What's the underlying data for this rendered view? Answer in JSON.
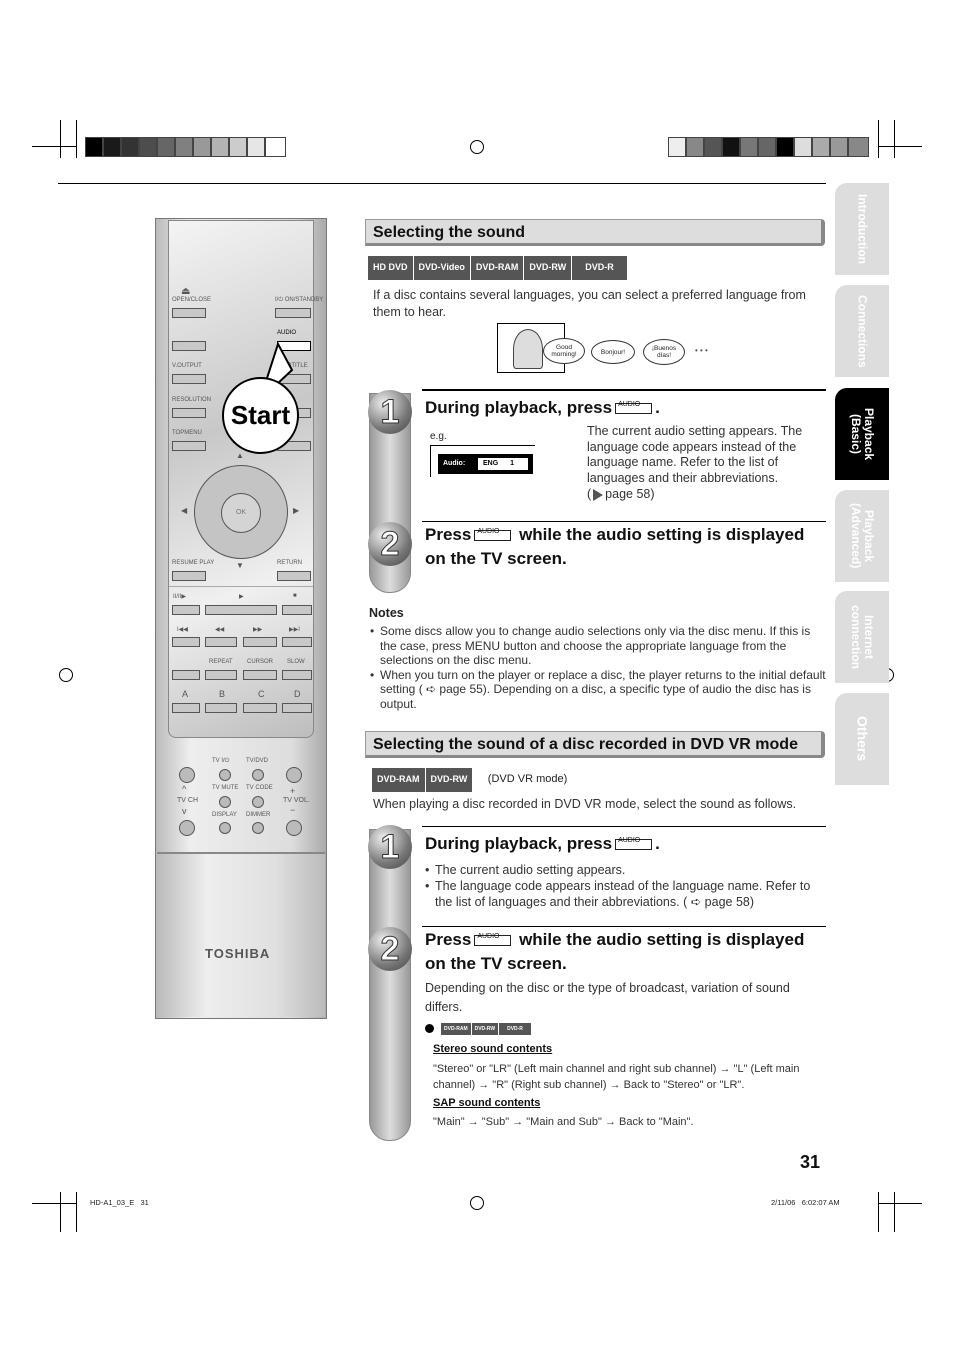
{
  "remote": {
    "brand": "TOSHIBA",
    "labels": {
      "open_close": "OPEN/CLOSE",
      "on_standby": "I/⏻ ON/STANDBY",
      "audio": "AUDIO",
      "v_output": "V.OUTPUT",
      "subtitle": "SUBTITLE",
      "resolution": "RESOLUTION",
      "topmenu": "TOPMENU",
      "ok": "OK",
      "resume_play": "RESUME PLAY",
      "return": "RETURN",
      "pause_step": "II/II▶",
      "play": "▶",
      "stop": "■",
      "skip_back": "I◀◀",
      "rew": "◀◀",
      "ff": "▶▶",
      "skip_fwd": "▶▶I",
      "repeat": "REPEAT",
      "cursor": "CURSOR",
      "slow": "SLOW",
      "a": "A",
      "b": "B",
      "c": "C",
      "d": "D",
      "tv_power": "TV I/⏻",
      "tv_dvd": "TV/DVD",
      "tv_mute": "TV MUTE",
      "tv_code": "TV CODE",
      "display": "DISPLAY",
      "dimmer": "DIMMER",
      "tv_ch": "TV CH",
      "tv_vol": "TV VOL.",
      "plus": "+",
      "minus": "−"
    },
    "callout": "Start"
  },
  "section1": {
    "title": "Selecting the sound",
    "badges": [
      "HD DVD",
      "DVD-Video",
      "DVD-RAM",
      "DVD-RW",
      "DVD-R"
    ],
    "intro": "If a disc contains several languages, you can select a preferred language from them to hear.",
    "bubbles": [
      "Good morning!",
      "Bonjour!",
      "¡Buenos días!",
      "• • •"
    ],
    "step1": {
      "number": "1",
      "heading": "During playback, press",
      "key": "AUDIO",
      "eg": "e.g.",
      "osd_label": "Audio:",
      "osd_value": "ENG",
      "osd_track": "1",
      "desc": "The current audio setting appears. The language code appears instead of the language name. Refer to the list of languages and their abbreviations.",
      "ref": "page 58"
    },
    "step2": {
      "number": "2",
      "heading_a": "Press",
      "key": "AUDIO",
      "heading_b": "while the audio setting is displayed on the TV screen."
    },
    "notes_title": "Notes",
    "notes": [
      "Some discs allow you to change audio selections only via the disc menu. If this is the case, press MENU button and choose the appropriate language from the selections on the disc menu.",
      "When you turn on the player or replace a disc, the player returns to the initial default setting ( ➪ page 55). Depending on a disc, a specific type of audio the disc has is output."
    ]
  },
  "section2": {
    "title": "Selecting the sound of a disc recorded in DVD VR mode",
    "badges": [
      "DVD-RAM",
      "DVD-RW"
    ],
    "mode": "(DVD VR mode)",
    "intro": "When playing a disc recorded in DVD VR mode, select the sound as follows.",
    "step1": {
      "number": "1",
      "heading": "During playback, press",
      "key": "AUDIO",
      "bullets": [
        "The current audio setting appears.",
        "The language code appears instead of the language name. Refer to the list of languages and their abbreviations. ( ➪ page 58)"
      ]
    },
    "step2": {
      "number": "2",
      "heading_a": "Press",
      "key": "AUDIO",
      "heading_b": "while the audio setting is displayed on the TV screen.",
      "desc": "Depending on the disc or the type of broadcast, variation of sound differs.",
      "badges": [
        "DVD-RAM",
        "DVD-RW",
        "DVD-R"
      ],
      "stereo_title": "Stereo sound contents",
      "stereo_text": "\"Stereo\" or \"LR\" (Left main channel and right sub channel) → \"L\" (Left main channel) → \"R\" (Right sub channel) → Back to \"Stereo\" or \"LR\".",
      "sap_title": "SAP sound contents",
      "sap_text": "\"Main\" → \"Sub\" → \"Main and Sub\" → Back to \"Main\"."
    }
  },
  "side_tabs": [
    {
      "label": "Introduction",
      "active": false
    },
    {
      "label": "Connections",
      "active": false
    },
    {
      "label": "Playback (Basic)",
      "active": true
    },
    {
      "label": "Playback (Advanced)",
      "active": false
    },
    {
      "label": "Internet connection",
      "active": false
    },
    {
      "label": "Others",
      "active": false
    }
  ],
  "page_number": "31",
  "footer": {
    "left": "HD-A1_03_E   31",
    "right": "2/11/06   6:02:07 AM"
  }
}
